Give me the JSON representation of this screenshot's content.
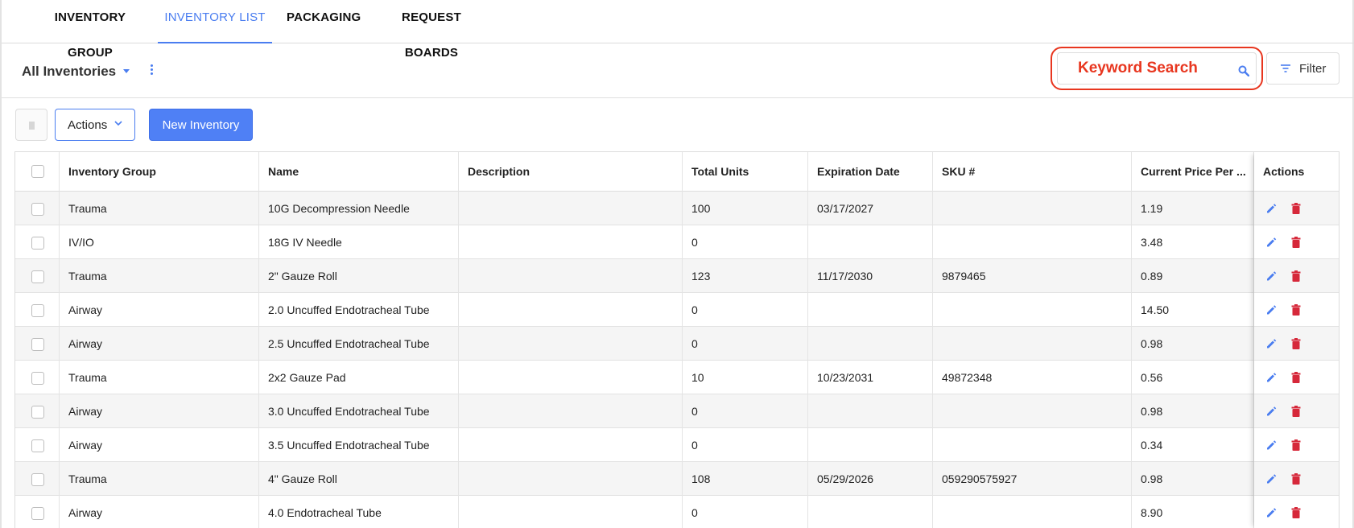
{
  "tabs": [
    {
      "label": "INVENTORY GROUP",
      "active": false
    },
    {
      "label": "INVENTORY LIST",
      "active": true
    },
    {
      "label": "PACKAGING",
      "active": false
    },
    {
      "label": "REQUEST BOARDS",
      "active": false
    }
  ],
  "header": {
    "view_label": "All Inventories",
    "search_placeholder": "Keyword Search",
    "filter_label": "Filter"
  },
  "toolbar": {
    "actions_label": "Actions",
    "new_label": "New Inventory"
  },
  "table": {
    "columns": [
      "Inventory Group",
      "Name",
      "Description",
      "Total Units",
      "Expiration Date",
      "SKU #",
      "Current Price Per ...",
      "Actions"
    ],
    "rows": [
      {
        "group": "Trauma",
        "name": "10G Decompression Needle",
        "description": "",
        "units": "100",
        "expiration": "03/17/2027",
        "sku": "",
        "price": "1.19"
      },
      {
        "group": "IV/IO",
        "name": "18G IV Needle",
        "description": "",
        "units": "0",
        "expiration": "",
        "sku": "",
        "price": "3.48"
      },
      {
        "group": "Trauma",
        "name": "2\" Gauze Roll",
        "description": "",
        "units": "123",
        "expiration": "11/17/2030",
        "sku": "9879465",
        "price": "0.89"
      },
      {
        "group": "Airway",
        "name": "2.0 Uncuffed Endotracheal Tube",
        "description": "",
        "units": "0",
        "expiration": "",
        "sku": "",
        "price": "14.50"
      },
      {
        "group": "Airway",
        "name": "2.5 Uncuffed Endotracheal Tube",
        "description": "",
        "units": "0",
        "expiration": "",
        "sku": "",
        "price": "0.98"
      },
      {
        "group": "Trauma",
        "name": "2x2 Gauze Pad",
        "description": "",
        "units": "10",
        "expiration": "10/23/2031",
        "sku": "49872348",
        "price": "0.56"
      },
      {
        "group": "Airway",
        "name": "3.0 Uncuffed Endotracheal Tube",
        "description": "",
        "units": "0",
        "expiration": "",
        "sku": "",
        "price": "0.98"
      },
      {
        "group": "Airway",
        "name": "3.5 Uncuffed Endotracheal Tube",
        "description": "",
        "units": "0",
        "expiration": "",
        "sku": "",
        "price": "0.34"
      },
      {
        "group": "Trauma",
        "name": "4\" Gauze Roll",
        "description": "",
        "units": "108",
        "expiration": "05/29/2026",
        "sku": "059290575927",
        "price": "0.98"
      },
      {
        "group": "Airway",
        "name": "4.0 Endotracheal Tube",
        "description": "",
        "units": "0",
        "expiration": "",
        "sku": "",
        "price": "8.90"
      }
    ]
  },
  "colors": {
    "accent": "#4a7df0",
    "highlight": "#e8361f",
    "delete": "#d6283a"
  },
  "icons": [
    "chevron-down-icon",
    "kebab-menu-icon",
    "search-icon",
    "filter-icon",
    "trash-icon",
    "edit-icon"
  ]
}
